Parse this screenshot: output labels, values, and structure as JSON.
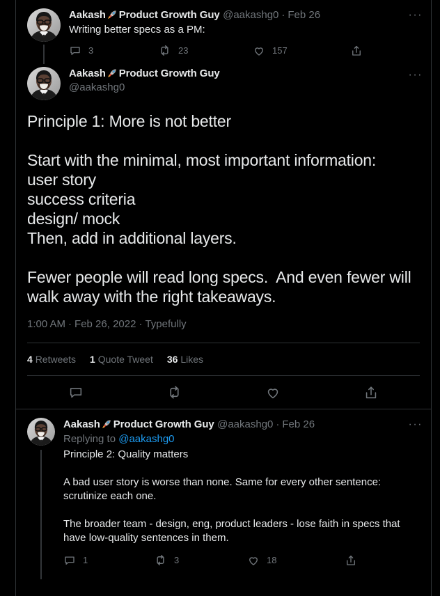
{
  "theme": {
    "background": "#000000",
    "text_primary": "#e7e9ea",
    "text_secondary": "#71767b",
    "border": "#2f3336",
    "link": "#1d9bf0",
    "thread_line": "#333639"
  },
  "tweets": [
    {
      "id": "tweet-1",
      "author": {
        "display_name": "Aakash",
        "name_suffix": "Product Growth Guy",
        "emoji": "rocket",
        "handle": "@aakashg0"
      },
      "date": "Feb 26",
      "separator": "·",
      "text": "Writing better specs as a PM:",
      "more_label": "···",
      "actions": {
        "reply_count": "3",
        "retweet_count": "23",
        "like_count": "157",
        "share_label": "share"
      }
    },
    {
      "id": "tweet-2",
      "author": {
        "display_name": "Aakash",
        "name_suffix": "Product Growth Guy",
        "emoji": "rocket",
        "handle": "@aakashg0"
      },
      "more_label": "···",
      "text": "Principle 1: More is not better\n\nStart with the minimal, most important information:\nuser story\nsuccess criteria\ndesign/ mock\nThen, add in additional layers.\n\nFewer people will read long specs.  And even fewer will walk away with the right takeaways.",
      "time": "1:00 AM",
      "date": "Feb 26, 2022",
      "source": "Typefully",
      "sep1": "·",
      "sep2": "·",
      "stats": {
        "retweets_count": "4",
        "retweets_label": "Retweets",
        "quotes_count": "1",
        "quotes_label": "Quote Tweet",
        "likes_count": "36",
        "likes_label": "Likes"
      }
    },
    {
      "id": "tweet-3",
      "author": {
        "display_name": "Aakash",
        "name_suffix": "Product Growth Guy",
        "emoji": "rocket",
        "handle": "@aakashg0"
      },
      "date": "Feb 26",
      "separator": "·",
      "more_label": "···",
      "replying_prefix": "Replying to",
      "replying_handle": "@aakashg0",
      "text": "Principle 2: Quality matters\n\nA bad user story is worse than none. Same for every other sentence: scrutinize each one.\n\nThe broader team - design, eng, product leaders - lose faith in specs that have low-quality sentences in them.",
      "actions": {
        "reply_count": "1",
        "retweet_count": "3",
        "like_count": "18",
        "share_label": "share"
      }
    }
  ]
}
